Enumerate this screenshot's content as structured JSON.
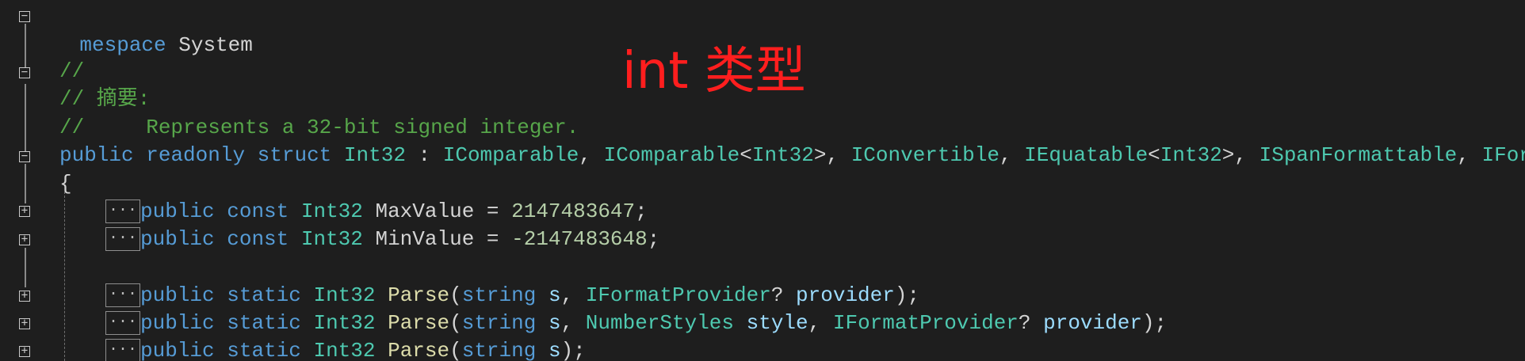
{
  "overlay": {
    "title": "int 类型",
    "color": "#ff1e1e"
  },
  "colors": {
    "background": "#1e1e1e",
    "keyword": "#569cd6",
    "type": "#4ec9b0",
    "comment": "#57a64a",
    "number": "#b5cea8",
    "method": "#dcdcaa",
    "parameter": "#9cdcfe",
    "plain": "#d4d4d4"
  },
  "code": {
    "line1": {
      "ns_partial": "mespace",
      "ns_name": "System"
    },
    "line3": {
      "comment": "//"
    },
    "line4": {
      "comment": "// 摘要:"
    },
    "line5": {
      "comment": "//     Represents a 32-bit signed integer."
    },
    "line6": {
      "kw1": "public",
      "kw2": "readonly",
      "kw3": "struct",
      "type": "Int32",
      "colon": " : ",
      "if1": "IComparable",
      "sep1": ", ",
      "if2": "IComparable",
      "lt2": "<",
      "t2": "Int32",
      "gt2": ">",
      "sep2": ", ",
      "if3": "IConvertible",
      "sep3": ", ",
      "if4": "IEquatable",
      "lt4": "<",
      "t4": "Int32",
      "gt4": ">",
      "sep4": ", ",
      "if5": "ISpanFormattable",
      "sep5": ", ",
      "if6": "IFormattable"
    },
    "line7": {
      "brace": "{"
    },
    "collapsed_marker": "...",
    "line8": {
      "kw1": "public",
      "kw2": "const",
      "type": "Int32",
      "name": " MaxValue = ",
      "value": "2147483647",
      "end": ";"
    },
    "line9": {
      "kw1": "public",
      "kw2": "const",
      "type": "Int32",
      "name": " MinValue = ",
      "value": "-2147483648",
      "end": ";"
    },
    "line11": {
      "kw1": "public",
      "kw2": "static",
      "type": "Int32",
      "method": "Parse",
      "open": "(",
      "p1type": "string",
      "p1": "s",
      "sep": ", ",
      "p2type": "IFormatProvider",
      "q": "? ",
      "p2": "provider",
      "close": ");"
    },
    "line12": {
      "kw1": "public",
      "kw2": "static",
      "type": "Int32",
      "method": "Parse",
      "open": "(",
      "p1type": "string",
      "p1": "s",
      "sep1": ", ",
      "p2type": "NumberStyles",
      "p2": "style",
      "sep2": ", ",
      "p3type": "IFormatProvider",
      "q": "? ",
      "p3": "provider",
      "close": ");"
    },
    "line13": {
      "kw1": "public",
      "kw2": "static",
      "type": "Int32",
      "method": "Parse",
      "open": "(",
      "p1type": "string",
      "p1": "s",
      "close": ");"
    }
  },
  "fold_glyphs": {
    "minus": "−",
    "plus": "+"
  }
}
